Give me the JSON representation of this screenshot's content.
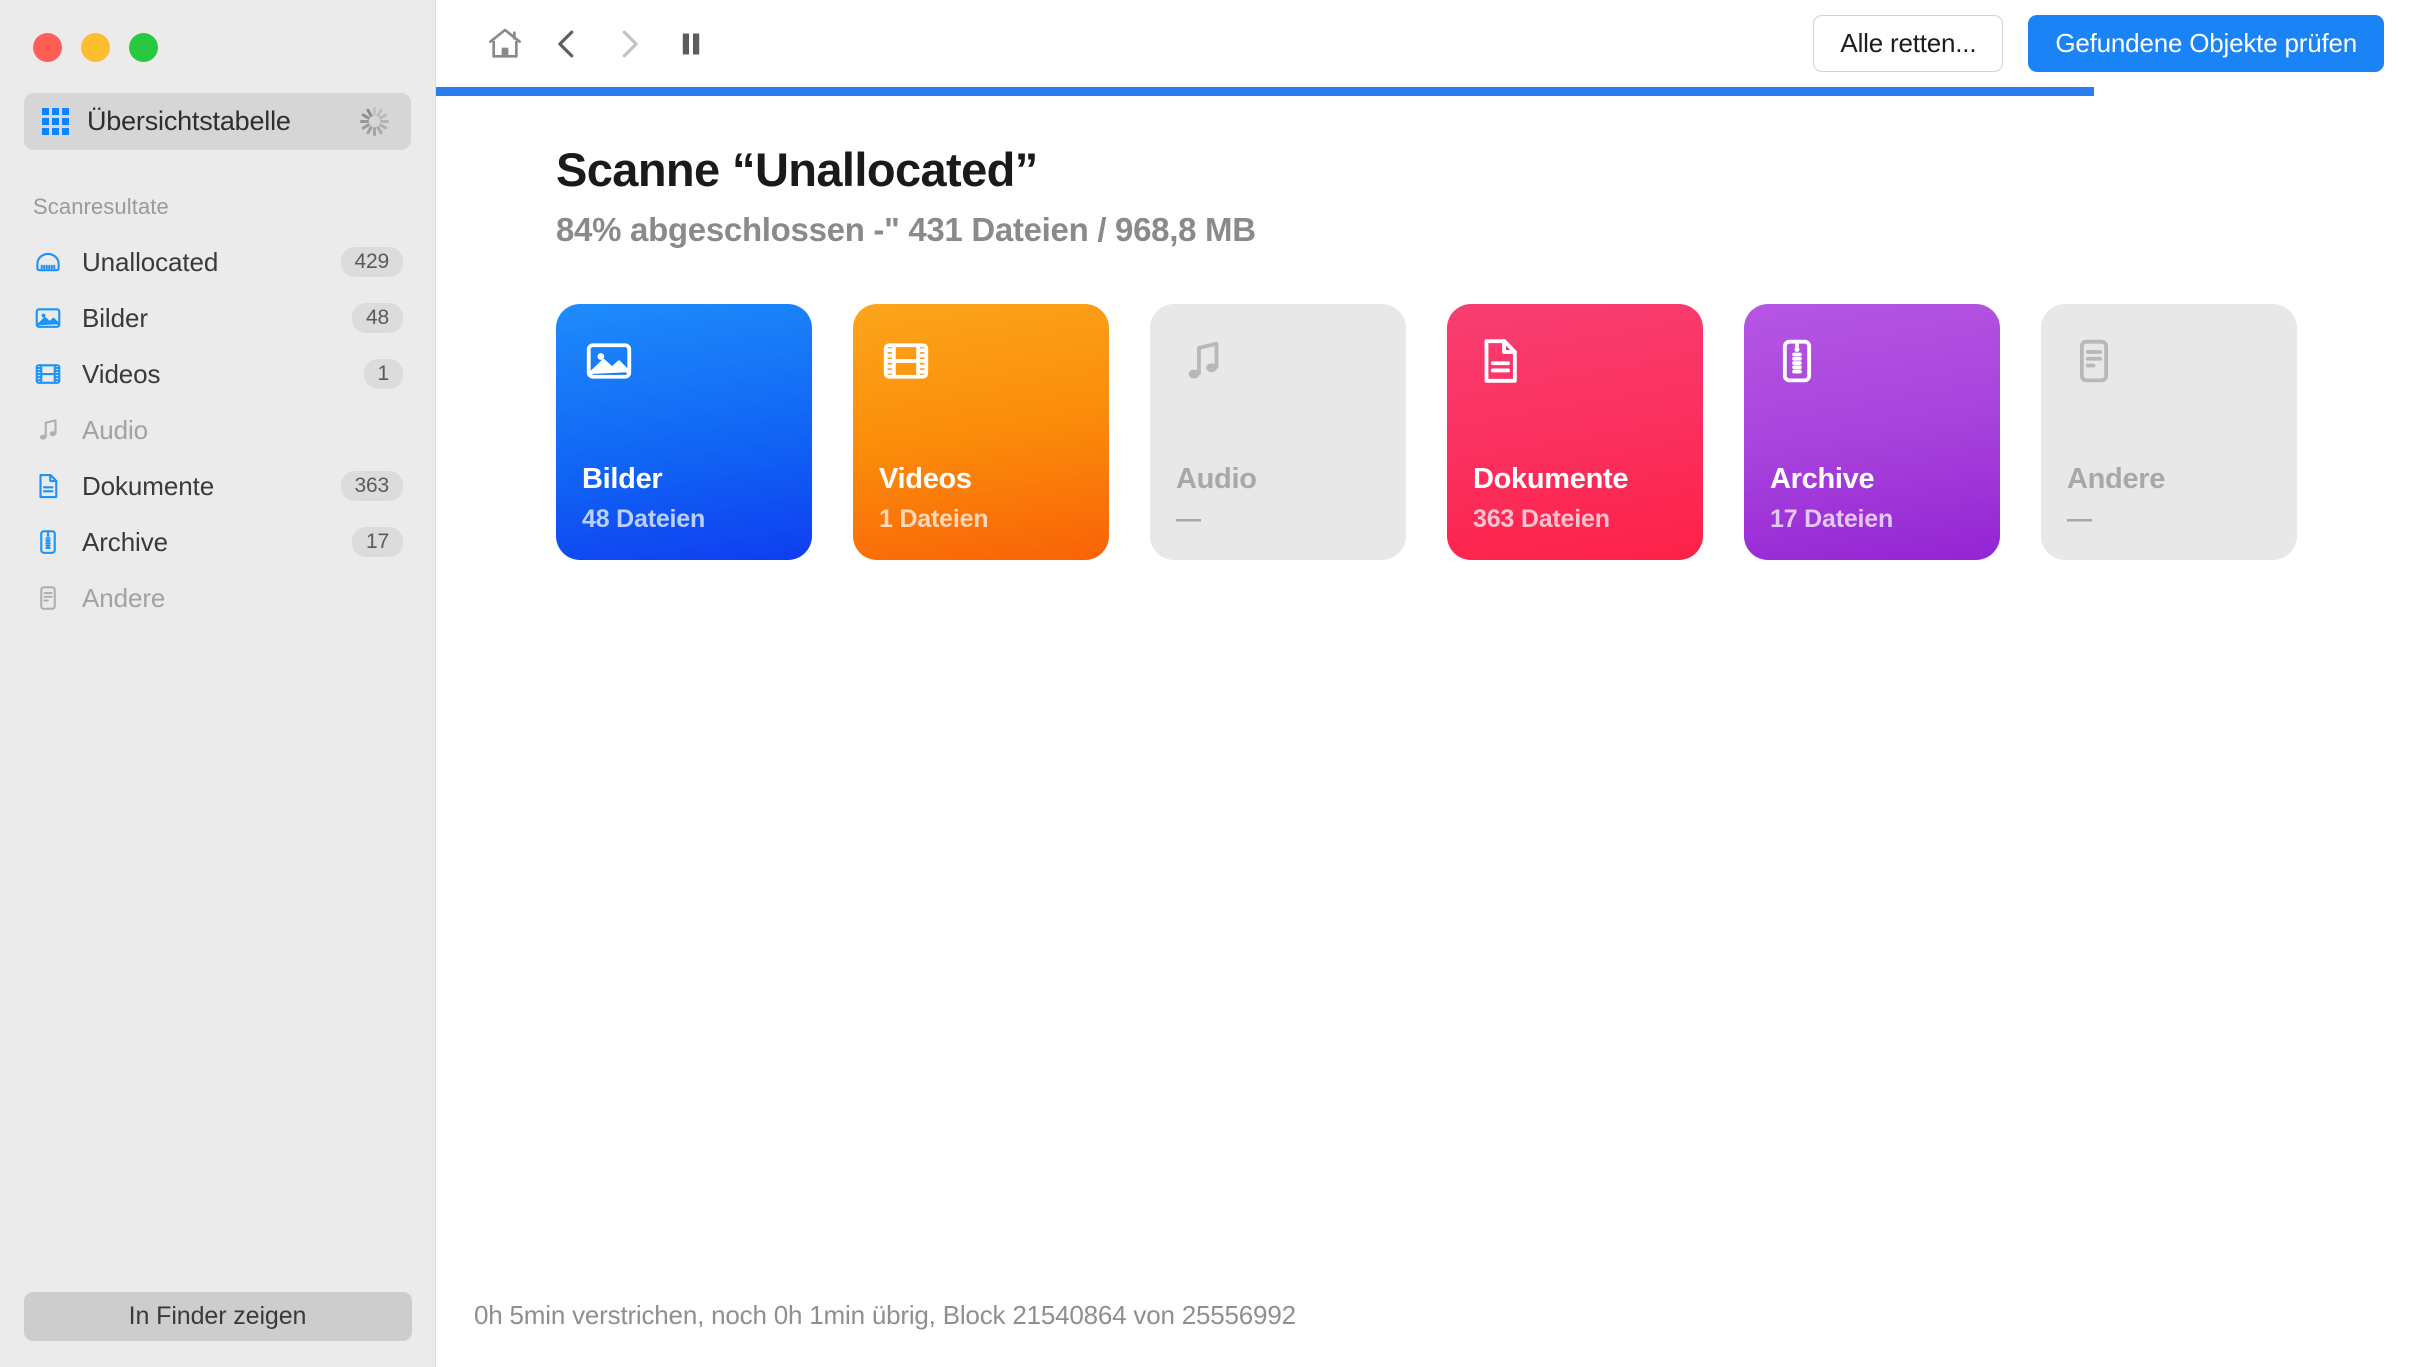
{
  "window": {
    "traffic_lights": [
      {
        "name": "close",
        "color": "#ff5f57"
      },
      {
        "name": "minimize",
        "color": "#febc2e"
      },
      {
        "name": "zoom",
        "color": "#28c840"
      }
    ]
  },
  "sidebar": {
    "overview": {
      "label": "Übersichtstabelle",
      "icon": "grid-icon",
      "busy_icon": "spinner-icon"
    },
    "section_title": "Scanresultate",
    "items": [
      {
        "label": "Unallocated",
        "count": "429",
        "icon": "hard-drive-icon",
        "enabled": true
      },
      {
        "label": "Bilder",
        "count": "48",
        "icon": "photo-icon",
        "enabled": true
      },
      {
        "label": "Videos",
        "count": "1",
        "icon": "film-icon",
        "enabled": true
      },
      {
        "label": "Audio",
        "count": "",
        "icon": "music-note-icon",
        "enabled": false
      },
      {
        "label": "Dokumente",
        "count": "363",
        "icon": "document-icon",
        "enabled": true
      },
      {
        "label": "Archive",
        "count": "17",
        "icon": "zip-icon",
        "enabled": true
      },
      {
        "label": "Andere",
        "count": "",
        "icon": "lines-doc-icon",
        "enabled": false
      }
    ],
    "footer_button": "In Finder zeigen"
  },
  "toolbar": {
    "home_icon": "home-icon",
    "back_icon": "chevron-left-icon",
    "forward_icon": "chevron-right-icon",
    "pause_icon": "pause-icon",
    "secondary_button": "Alle retten...",
    "primary_button": "Gefundene Objekte prüfen",
    "accent_color": "#1a84f7"
  },
  "progress": {
    "percent": 84,
    "bar_color": "#2a7def"
  },
  "main": {
    "title": "Scanne “Unallocated”",
    "subtitle": "84% abgeschlossen -\" 431 Dateien / 968,8 MB",
    "cards": [
      {
        "name": "Bilder",
        "count": "48 Dateien",
        "icon": "photo-icon",
        "theme": "c-blue",
        "color": "#1166f5"
      },
      {
        "name": "Videos",
        "count": "1 Dateien",
        "icon": "film-icon",
        "theme": "c-orange",
        "color": "#fb8c0a"
      },
      {
        "name": "Audio",
        "count": "—",
        "icon": "music-note-icon",
        "theme": "c-gray",
        "color": "#e8e8e8"
      },
      {
        "name": "Dokumente",
        "count": "363 Dateien",
        "icon": "document-icon",
        "theme": "c-pink",
        "color": "#fb2f5d"
      },
      {
        "name": "Archive",
        "count": "17 Dateien",
        "icon": "zip-icon",
        "theme": "c-purple",
        "color": "#a843dc"
      },
      {
        "name": "Andere",
        "count": "—",
        "icon": "lines-doc-icon",
        "theme": "c-gray",
        "color": "#e8e8e8"
      }
    ]
  },
  "status": {
    "text": "0h 5min verstrichen, noch 0h 1min übrig, Block 21540864 von 25556992"
  }
}
